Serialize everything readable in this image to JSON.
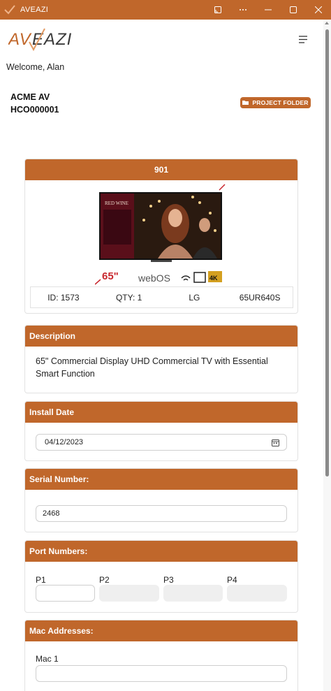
{
  "window": {
    "title": "AVEAZI"
  },
  "brand": {
    "accent": "#c0672b",
    "logo_text": "AVEAZI"
  },
  "header": {
    "welcome": "Welcome, Alan"
  },
  "project": {
    "company": "ACME AV",
    "code": "HCO000001",
    "folder_button": "PROJECT FOLDER"
  },
  "product": {
    "name": "901",
    "image_text": {
      "size": "65\"",
      "brand": "webOS",
      "poster": "RED WINE",
      "badge": "4K"
    },
    "id": "ID: 1573",
    "qty": "QTY: 1",
    "make": "LG",
    "model": "65UR640S"
  },
  "description": {
    "heading": "Description",
    "text": "65\" Commercial Display UHD Commercial TV with Essential Smart Function"
  },
  "install_date": {
    "heading": "Install Date",
    "value": "04/12/2023"
  },
  "serial": {
    "heading": "Serial Number:",
    "value": "2468"
  },
  "ports": {
    "heading": "Port Numbers:",
    "labels": [
      "P1",
      "P2",
      "P3",
      "P4"
    ]
  },
  "mac": {
    "heading": "Mac Addresses:",
    "label": "Mac 1"
  }
}
